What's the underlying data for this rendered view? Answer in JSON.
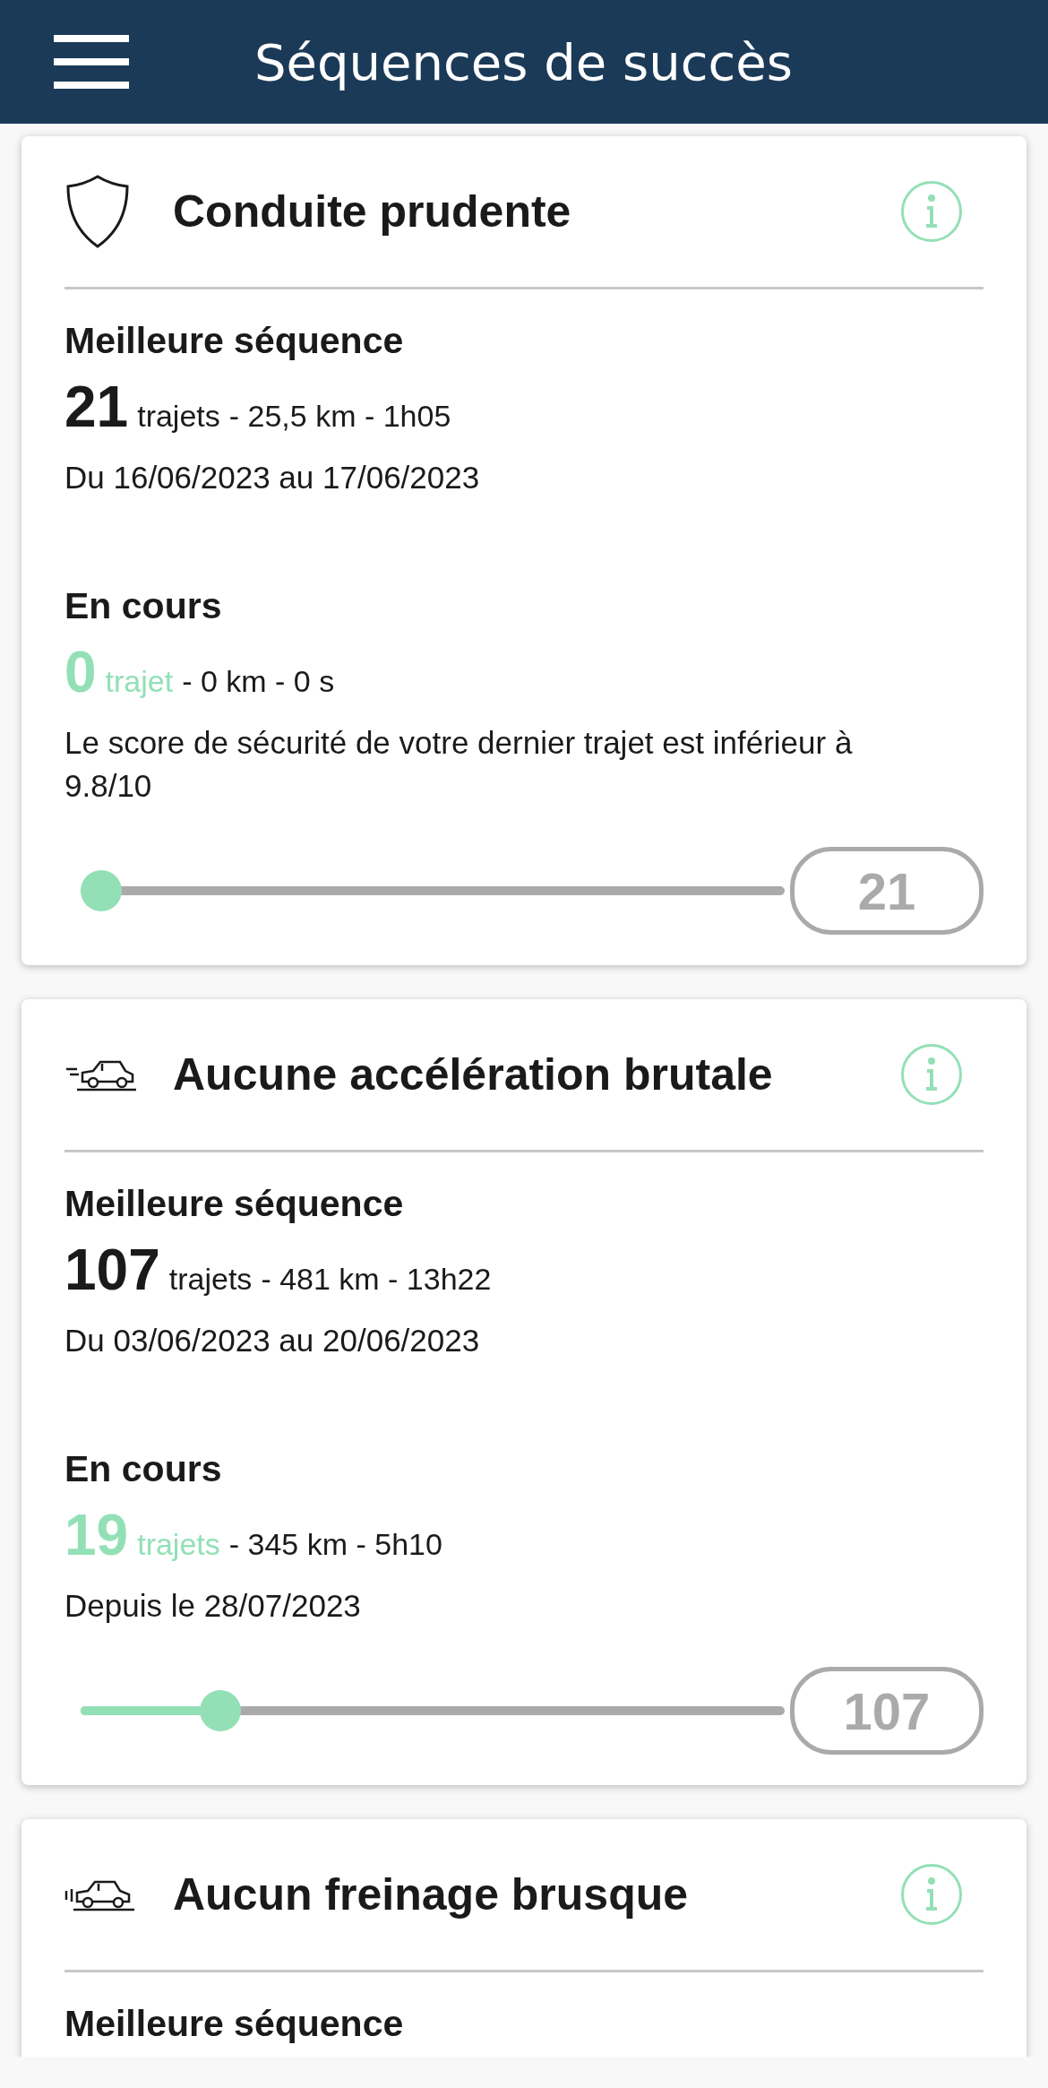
{
  "header": {
    "title": "Séquences de succès"
  },
  "cards": [
    {
      "kind": "shield",
      "title": "Conduite prudente",
      "best": {
        "label": "Meilleure séquence",
        "count": "21",
        "unit": "trajets",
        "details": "- 25,5 km - 1h05",
        "dates": "Du 16/06/2023 au 17/06/2023"
      },
      "current": {
        "label": "En cours",
        "count": "0",
        "unit": "trajet",
        "details": "- 0 km - 0 s",
        "note": "Le score de sécurité de votre dernier trajet est inférieur à 9.8/10"
      },
      "progress": {
        "level": 0,
        "target": "21"
      }
    },
    {
      "kind": "car-accelerate",
      "title": "Aucune accélération brutale",
      "best": {
        "label": "Meilleure séquence",
        "count": "107",
        "unit": "trajets",
        "details": "- 481 km - 13h22",
        "dates": "Du 03/06/2023 au 20/06/2023"
      },
      "current": {
        "label": "En cours",
        "count": "19",
        "unit": "trajets",
        "details": "- 345 km - 5h10",
        "note": "Depuis le 28/07/2023"
      },
      "progress": {
        "level": 0.18,
        "target": "107"
      }
    },
    {
      "kind": "car-brake",
      "title": "Aucun freinage brusque",
      "best": {
        "label": "Meilleure séquence"
      }
    }
  ]
}
